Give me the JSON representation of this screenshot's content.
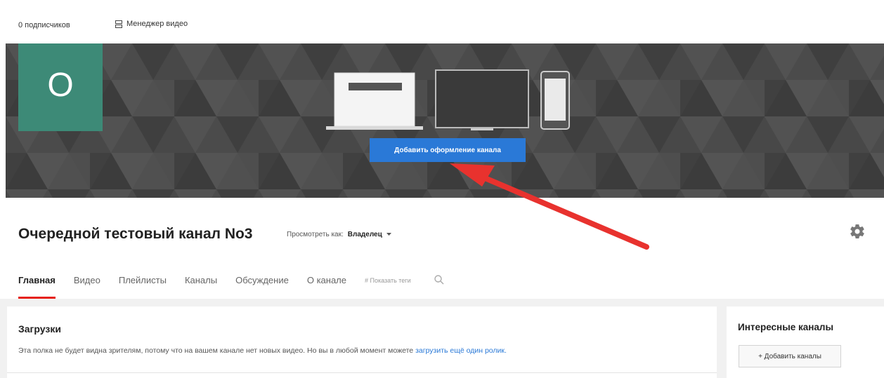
{
  "header": {
    "subscribers": "0 подписчиков",
    "video_manager": "Менеджер видео"
  },
  "banner": {
    "avatar_letter": "О",
    "add_art_button": "Добавить оформление канала"
  },
  "channel": {
    "title": "Очередной тестовый канал No3",
    "view_as_label": "Просмотреть как:",
    "view_as_value": "Владелец"
  },
  "tabs": [
    "Главная",
    "Видео",
    "Плейлисты",
    "Каналы",
    "Обсуждение",
    "О канале"
  ],
  "show_tags": "# Показать теги",
  "uploads": {
    "title": "Загрузки",
    "text": "Эта полка не будет видна зрителям, потому что на вашем канале нет новых видео. Но вы в любой момент можете ",
    "link": "загрузить ещё один ролик."
  },
  "featured": {
    "title": "Интересные каналы",
    "add_button": "+ Добавить каналы"
  },
  "icons": {
    "video_manager": "grid-icon",
    "dropdown": "caret-down-icon",
    "settings": "gear-icon",
    "search": "search-icon",
    "annotation": "red-arrow"
  },
  "colors": {
    "avatar": "#3d8a77",
    "primary_button": "#2a79d7",
    "active_tab": "#e62117",
    "annotation": "#e8322e"
  }
}
